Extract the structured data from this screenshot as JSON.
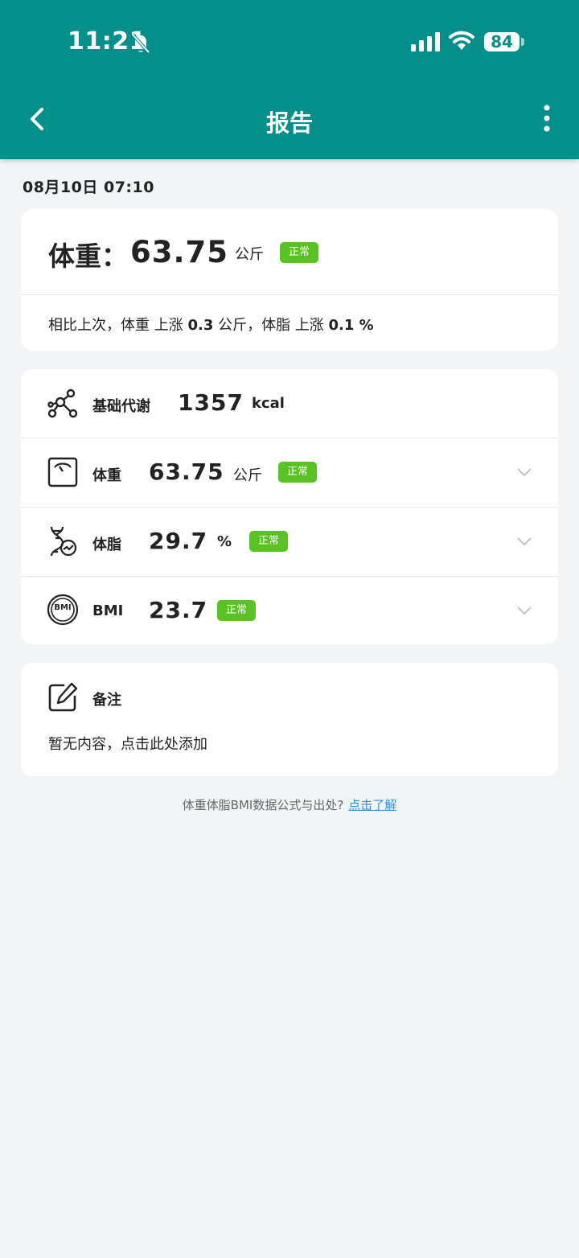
{
  "status_bar": {
    "time": "11:21",
    "battery": "84"
  },
  "header": {
    "title": "报告"
  },
  "date": "08月10日 07:10",
  "summary": {
    "label": "体重：",
    "value": "63.75",
    "unit": "公斤",
    "badge": "正常",
    "compare_prefix": "相比上次，体重 上涨 ",
    "weight_delta": "0.3",
    "compare_mid": " 公斤，体脂 上涨 ",
    "fat_delta": "0.1 %"
  },
  "metrics": [
    {
      "label": "基础代谢",
      "value": "1357",
      "unit": "kcal",
      "icon": "molecule-icon"
    },
    {
      "label": "体重",
      "value": "63.75",
      "unit": "公斤",
      "badge": "正常",
      "icon": "scale-icon"
    },
    {
      "label": "体脂",
      "value": "29.7",
      "unit": "%",
      "badge": "正常",
      "icon": "dna-icon"
    },
    {
      "label": "BMI",
      "value": "23.7",
      "badge": "正常",
      "icon": "bmi-icon",
      "icon_text": "BMI"
    }
  ],
  "note": {
    "label": "备注",
    "placeholder": "暂无内容，点击此处添加"
  },
  "footer": {
    "text": "体重体脂BMI数据公式与出处?",
    "link": "点击了解"
  },
  "colors": {
    "header": "#058f8b",
    "badge": "#58c322",
    "link": "#2f8fe0"
  }
}
